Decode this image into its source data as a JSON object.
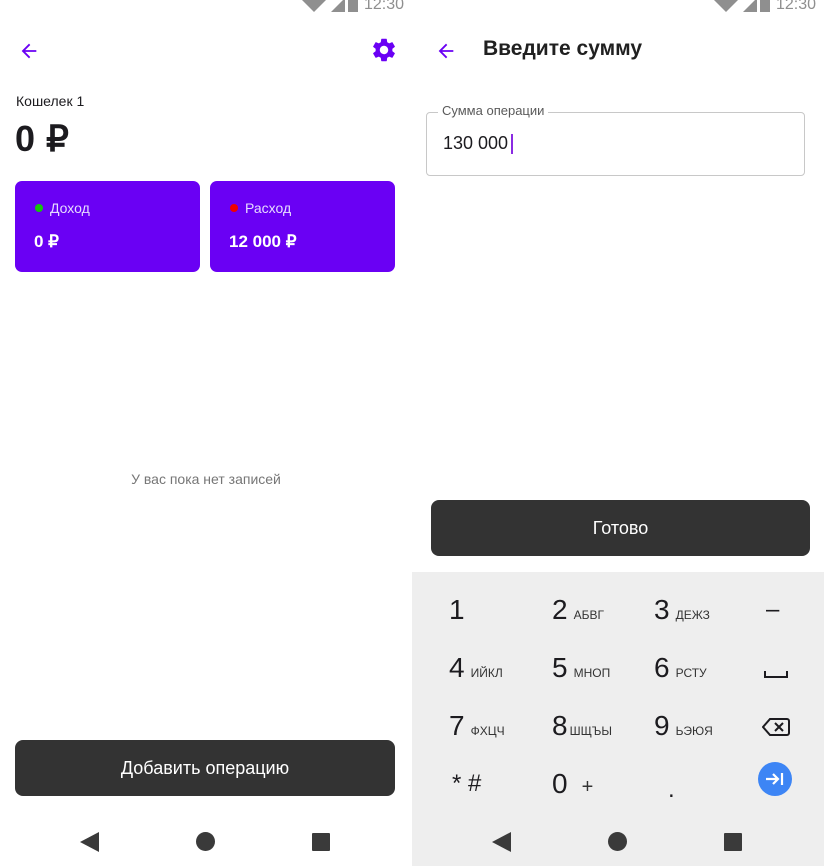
{
  "status_bar": {
    "time": "12:30"
  },
  "wallet_screen": {
    "wallet_name": "Кошелек 1",
    "balance": "0 ₽",
    "income": {
      "label": "Доход",
      "value": "0 ₽",
      "dot_color": "#16c60c"
    },
    "expense": {
      "label": "Расход",
      "value": "12 000 ₽",
      "dot_color": "#f00000"
    },
    "empty_text": "У вас пока нет записей",
    "add_button": "Добавить операцию"
  },
  "amount_screen": {
    "title": "Введите сумму",
    "field_label": "Сумма операции",
    "field_value": "130 000",
    "done_button": "Готово"
  },
  "keyboard": {
    "rows": [
      [
        {
          "digit": "1",
          "letters": ""
        },
        {
          "digit": "2",
          "letters": "АБВГ"
        },
        {
          "digit": "3",
          "letters": "ДЕЖЗ"
        },
        {
          "symbol": "–"
        }
      ],
      [
        {
          "digit": "4",
          "letters": "ИЙКЛ"
        },
        {
          "digit": "5",
          "letters": "МНОП"
        },
        {
          "digit": "6",
          "letters": "РСТУ"
        },
        {
          "symbol": "space"
        }
      ],
      [
        {
          "digit": "7",
          "letters": "ФХЦЧ"
        },
        {
          "digit": "8",
          "letters": "ШЩЪЫ"
        },
        {
          "digit": "9",
          "letters": "ЬЭЮЯ"
        },
        {
          "symbol": "backspace"
        }
      ],
      [
        {
          "digit": "* #",
          "letters": ""
        },
        {
          "digit": "0",
          "letters": "+"
        },
        {
          "digit": ".",
          "letters": ""
        },
        {
          "symbol": "enter"
        }
      ]
    ]
  },
  "colors": {
    "accent": "#6a00f4",
    "button_dark": "#333333",
    "enter_key": "#3d85f5"
  }
}
